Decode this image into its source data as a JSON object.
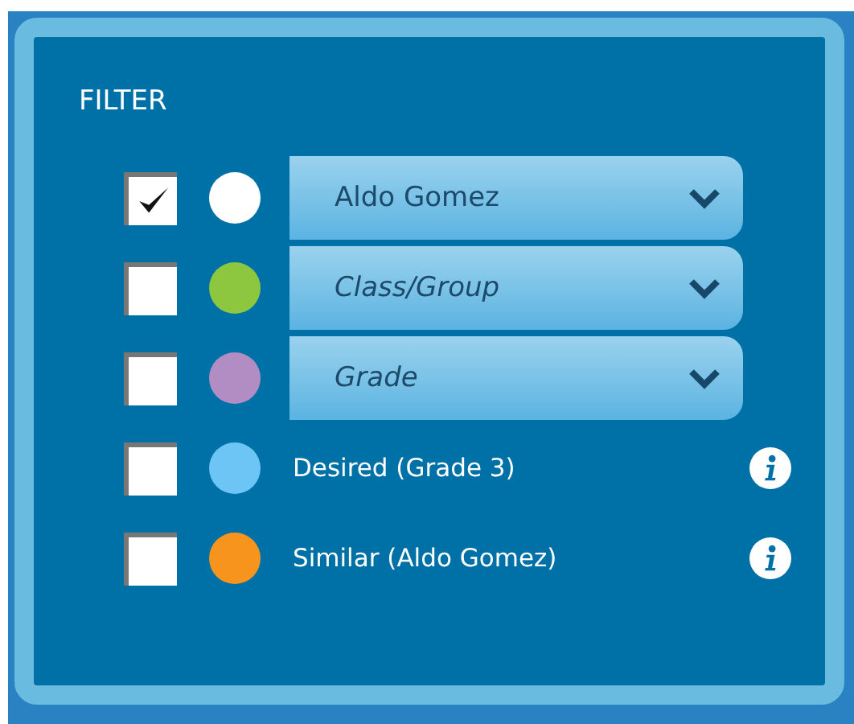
{
  "panel": {
    "title": "FILTER"
  },
  "filters": [
    {
      "kind": "dropdown",
      "checked": true,
      "color": "#ffffff",
      "value": "Aldo Gomez"
    },
    {
      "kind": "dropdown",
      "checked": false,
      "color": "#8dc63f",
      "placeholder": "Class/Group"
    },
    {
      "kind": "dropdown",
      "checked": false,
      "color": "#b28dc4",
      "placeholder": "Grade"
    },
    {
      "kind": "label",
      "checked": false,
      "color": "#6cc5f5",
      "label": "Desired (Grade 3)"
    },
    {
      "kind": "label",
      "checked": false,
      "color": "#f7941d",
      "label": "Similar (Aldo Gomez)"
    }
  ]
}
